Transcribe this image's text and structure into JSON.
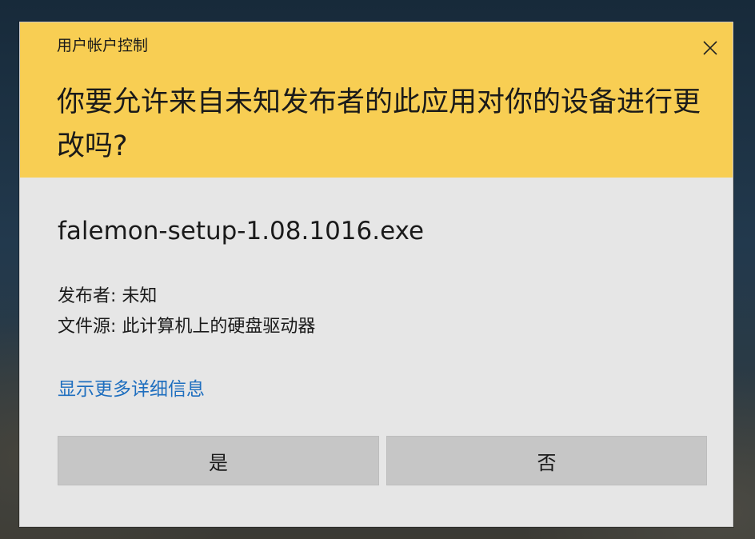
{
  "dialog": {
    "title": "用户帐户控制",
    "question": "你要允许来自未知发布者的此应用对你的设备进行更改吗?",
    "file_name": "falemon-setup-1.08.1016.exe",
    "publisher_label": "发布者:",
    "publisher_value": "未知",
    "source_label": "文件源:",
    "source_value": "此计算机上的硬盘驱动器",
    "details_link": "显示更多详细信息",
    "yes_label": "是",
    "no_label": "否",
    "close_icon": "close-icon"
  },
  "colors": {
    "header_bg": "#f8ce53",
    "body_bg": "#e6e6e6",
    "link": "#1f6fbf",
    "button_bg": "#c6c6c6"
  }
}
